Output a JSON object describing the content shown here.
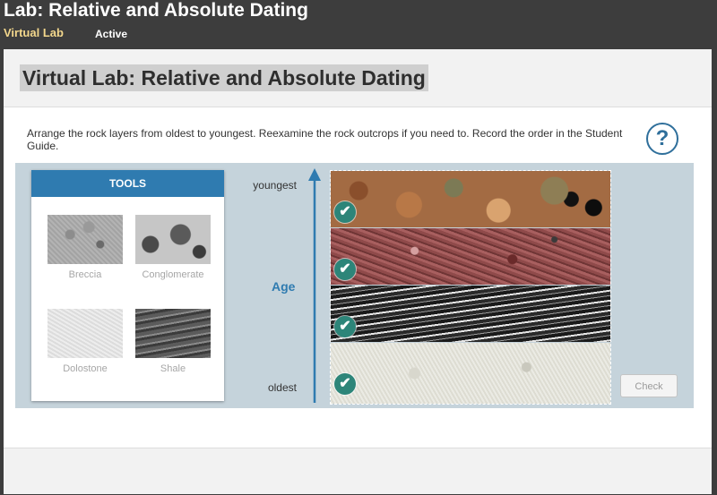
{
  "header": {
    "title": "Lab: Relative and Absolute Dating",
    "subtitle": "Virtual Lab",
    "status": "Active"
  },
  "lab": {
    "title": "Virtual Lab: Relative and Absolute Dating",
    "instructions": "Arrange the rock layers from oldest to youngest. Reexamine the rock outcrops if you need to. Record the order in the Student Guide.",
    "help_icon": "?"
  },
  "tools": {
    "heading": "TOOLS",
    "items": [
      {
        "label": "Breccia"
      },
      {
        "label": "Conglomerate"
      },
      {
        "label": "Dolostone"
      },
      {
        "label": "Shale"
      }
    ]
  },
  "age_axis": {
    "title": "Age",
    "top_label": "youngest",
    "bottom_label": "oldest",
    "color": "#2f7bb0"
  },
  "layers": [
    {
      "rock": "conglomerate",
      "correct": true
    },
    {
      "rock": "breccia",
      "correct": true
    },
    {
      "rock": "shale",
      "correct": true
    },
    {
      "rock": "dolostone",
      "correct": true
    }
  ],
  "check_icon": "✔",
  "check_button": "Check",
  "colors": {
    "accent": "#2f7bb0",
    "check": "#2d8579",
    "header_bg": "#3d3d3d",
    "subtitle": "#f3d78c"
  }
}
